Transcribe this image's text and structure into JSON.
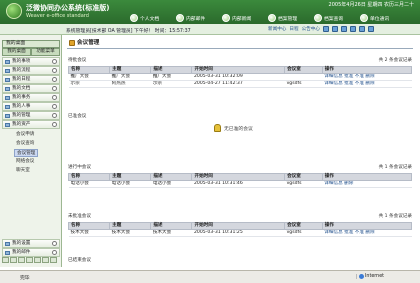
{
  "header": {
    "brand": "泛微协同办公系统(标准版)",
    "subbrand": "Weaver e-office standard",
    "date": "2005年4月26日 星期四 农历三月二十",
    "nav": [
      "个人文档",
      "内部邮件",
      "内部新闻",
      "档案管理",
      "档案查询",
      "单位通讯"
    ]
  },
  "subbar": {
    "path": "系统管理员[技术部  OA 管理员] 下午好！ 时间：15:57:37",
    "tools": [
      "刷新",
      "上一页",
      "下一页",
      "主页",
      "收藏",
      "帮助"
    ],
    "mid": [
      "新闻中心",
      "日程",
      "公告中心"
    ]
  },
  "sidebar": {
    "title": "我的桌面",
    "tabs": [
      "我的桌面",
      "功能菜单"
    ],
    "items": [
      "我的事项",
      "我的流程",
      "我的日程",
      "我的文档",
      "我的事务",
      "我的人事",
      "我的管理",
      "我的资产"
    ],
    "sub": [
      "会议申请",
      "会议查询",
      "会议管理",
      "网络会议",
      "聊天室"
    ],
    "selected": "会议管理",
    "bottom": [
      "我的设置",
      "我的邮件"
    ]
  },
  "main": {
    "title": "会议管理",
    "s1": {
      "label": "待批会议",
      "count": "共 2 条会议记录",
      "cols": [
        "名称",
        "主题",
        "描述",
        "开始时间",
        "会议室",
        "操作"
      ],
      "rows": [
        [
          "推广大会",
          "推广大会",
          "推广大会",
          "2005-03-31 10:32:09",
          "",
          "详细信息 批准 不准 删除"
        ],
        [
          "示宗",
          "阿热热",
          "示宗",
          "2005-04-27 11:42:37",
          "vgsdfs",
          "详细信息 批准 不准 删除"
        ]
      ]
    },
    "s2": {
      "label": "已准会议",
      "empty": "无已准的会议"
    },
    "s3": {
      "label": "进行中会议",
      "count": "共 1 条会议记录",
      "cols": [
        "名称",
        "主题",
        "描述",
        "开始时间",
        "会议室",
        "操作"
      ],
      "rows": [
        [
          "电话小会",
          "电话小会",
          "电话小会",
          "2005-03-31 10:31:46",
          "vgsdfs",
          "详细信息 删除"
        ]
      ]
    },
    "s4": {
      "label": "未批准会议",
      "count": "共 1 条会议记录",
      "cols": [
        "名称",
        "主题",
        "描述",
        "开始时间",
        "会议室",
        "操作"
      ],
      "rows": [
        [
          "技术大会",
          "技术大会",
          "技术大会",
          "2005-03-31 10:31:25",
          "vgsdfs",
          "详细信息 批准 不准 删除"
        ]
      ]
    },
    "s5": {
      "label": "已结束会议"
    }
  },
  "status": {
    "left": "完毕",
    "zone": "Internet"
  }
}
